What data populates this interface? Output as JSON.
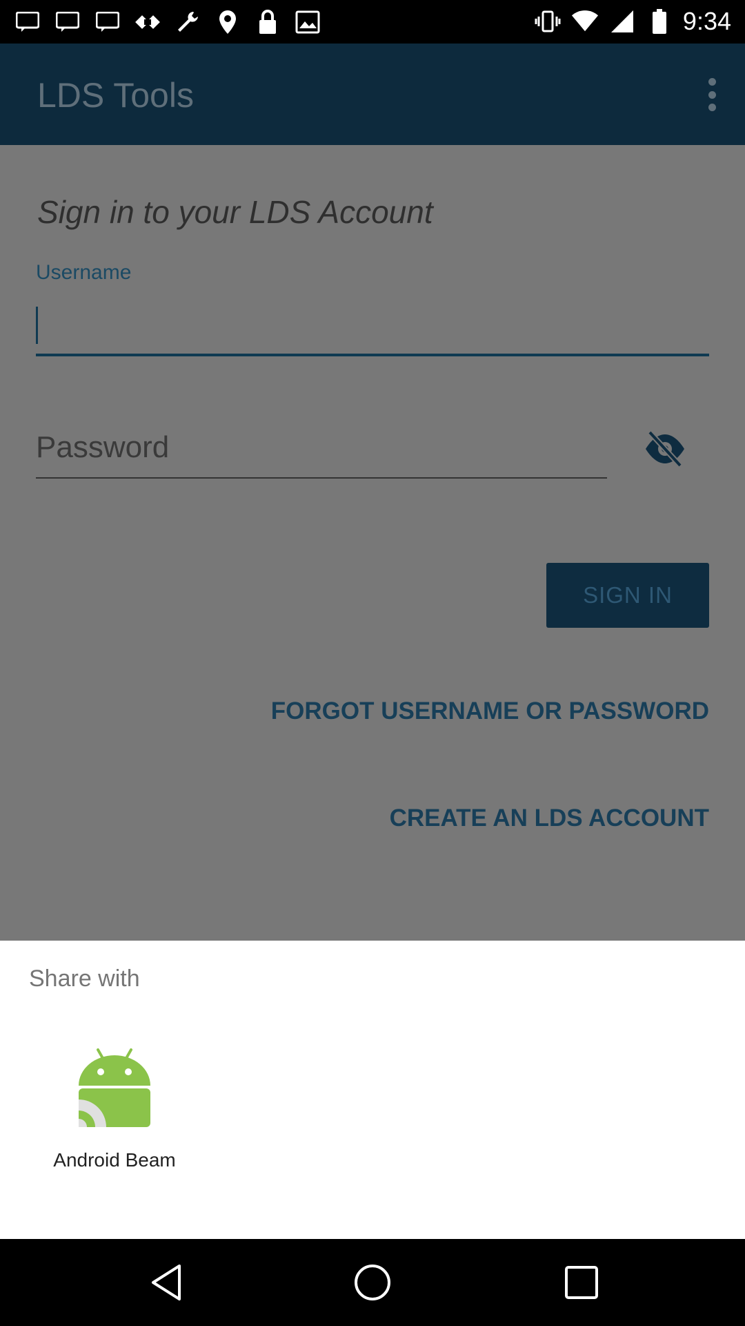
{
  "status_bar": {
    "time": "9:34",
    "left_icons": [
      "notification-icon",
      "notification-icon",
      "notification-icon",
      "fake-gps-icon",
      "wrench-icon",
      "location-icon",
      "lock-icon",
      "image-icon"
    ],
    "right_icons": [
      "vibrate-icon",
      "wifi-icon",
      "signal-icon",
      "battery-icon"
    ]
  },
  "app_bar": {
    "title": "LDS Tools",
    "menu_icon": "overflow-menu-icon"
  },
  "login": {
    "heading": "Sign in to your LDS Account",
    "username_label": "Username",
    "username_value": "",
    "password_placeholder": "Password",
    "password_visibility_icon": "eye-off-icon",
    "signin_label": "SIGN IN",
    "forgot_label": "FORGOT USERNAME OR PASSWORD",
    "create_label": "CREATE AN LDS ACCOUNT"
  },
  "share_sheet": {
    "title": "Share with",
    "targets": [
      {
        "label": "Android Beam",
        "icon": "android-beam-icon"
      }
    ]
  },
  "nav_bar": {
    "buttons": [
      "back-icon",
      "home-icon",
      "recents-icon"
    ]
  },
  "colors": {
    "app_bar": "#0d2a3d",
    "accent": "#173f58",
    "scrim_content": "#787878",
    "sheet": "#ffffff",
    "android_green": "#8bc34a"
  }
}
